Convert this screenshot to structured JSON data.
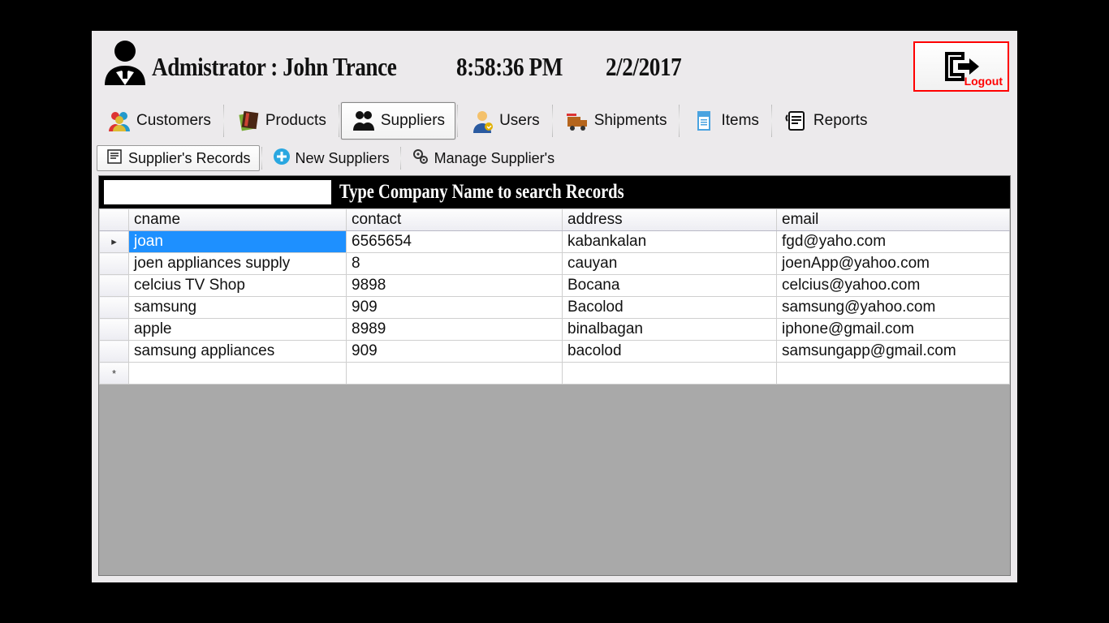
{
  "header": {
    "admin_label": "Admistrator :   John  Trance",
    "time": "8:58:36 PM",
    "date": "2/2/2017",
    "logout_label": "Logout"
  },
  "nav": {
    "customers": "Customers",
    "products": "Products",
    "suppliers": "Suppliers",
    "users": "Users",
    "shipments": "Shipments",
    "items": "Items",
    "reports": "Reports"
  },
  "subnav": {
    "records": "Supplier's Records",
    "new": "New Suppliers",
    "manage": "Manage Supplier's"
  },
  "search": {
    "value": "",
    "label": "Type Company Name to search Records"
  },
  "table": {
    "columns": {
      "cname": "cname",
      "contact": "contact",
      "address": "address",
      "email": "email"
    },
    "rows": [
      {
        "cname": "joan",
        "contact": "6565654",
        "address": "kabankalan",
        "email": "fgd@yaho.com",
        "selected": true
      },
      {
        "cname": "joen appliances supply",
        "contact": "8",
        "address": "cauyan",
        "email": "joenApp@yahoo.com"
      },
      {
        "cname": "celcius TV Shop",
        "contact": "9898",
        "address": "Bocana",
        "email": "celcius@yahoo.com"
      },
      {
        "cname": "samsung",
        "contact": "909",
        "address": "Bacolod",
        "email": "samsung@yahoo.com"
      },
      {
        "cname": "apple",
        "contact": "8989",
        "address": "binalbagan",
        "email": "iphone@gmail.com"
      },
      {
        "cname": "samsung appliances",
        "contact": "909",
        "address": "bacolod",
        "email": "samsungapp@gmail.com"
      }
    ]
  }
}
